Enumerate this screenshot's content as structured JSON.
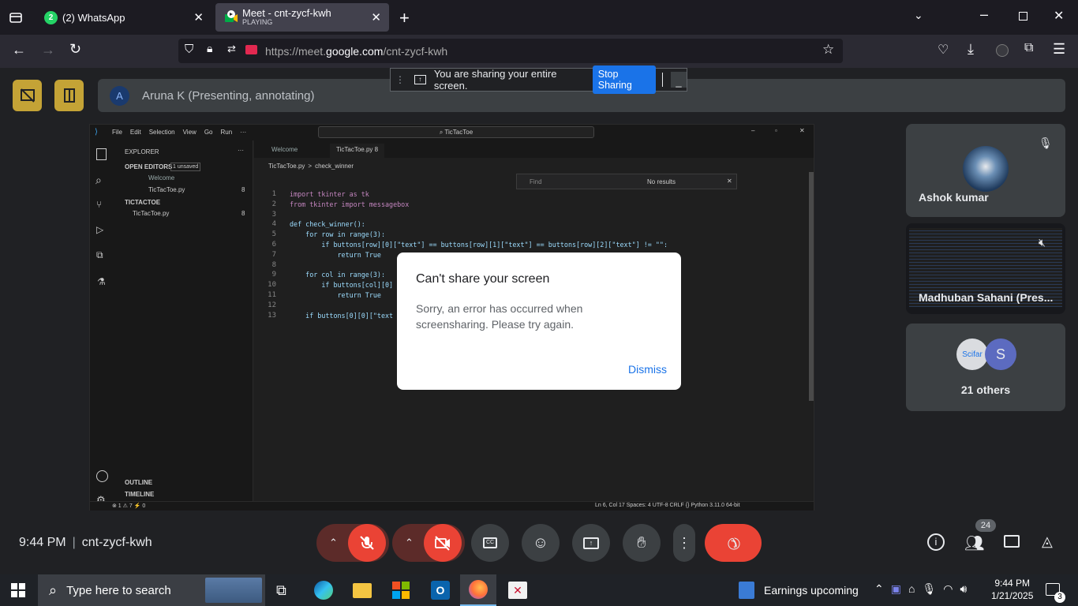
{
  "browser": {
    "tabs": [
      {
        "title": "(2) WhatsApp",
        "badge": "2"
      },
      {
        "title": "Meet - cnt-zycf-kwh",
        "subtitle": "PLAYING"
      }
    ],
    "url_prefix": "https://meet.",
    "url_domain": "google.com",
    "url_suffix": "/cnt-zycf-kwh"
  },
  "share_bar": {
    "message": "You are sharing your entire screen.",
    "stop_label": "Stop Sharing",
    "minimize_label": "_"
  },
  "meet": {
    "presenter_avatar": "A",
    "presenter_label": "Aruna K (Presenting, annotating)",
    "time": "9:44 PM",
    "separator": "|",
    "meeting_code": "cnt-zycf-kwh",
    "participant_count": "24",
    "tiles": [
      {
        "name": "Ashok kumar"
      },
      {
        "name": "Madhuban Sahani (Pres..."
      },
      {
        "name": "21 others",
        "avatars": [
          "Scifar",
          "S"
        ]
      }
    ]
  },
  "dialog": {
    "title": "Can't share your screen",
    "body": "Sorry, an error has occurred when screensharing. Please try again.",
    "dismiss_label": "Dismiss"
  },
  "vscode": {
    "menu": [
      "File",
      "Edit",
      "Selection",
      "View",
      "Go",
      "Run",
      "···"
    ],
    "search": "TicTacToe",
    "explorer_title": "EXPLORER",
    "open_editors": "OPEN EDITORS",
    "unsaved": "1 unsaved",
    "open_files": [
      "Welcome",
      "TicTacToe.py"
    ],
    "folder": "TICTACTOE",
    "folder_file": "TicTacToe.py",
    "file_badge": "8",
    "tabs": [
      "Welcome",
      "TicTacToe.py 8"
    ],
    "breadcrumb": [
      "TicTacToe.py",
      ">",
      "check_winner"
    ],
    "find_placeholder": "Find",
    "find_result": "No results",
    "outline": "OUTLINE",
    "timeline": "TIMELINE",
    "line_numbers": [
      "1",
      "2",
      "3",
      "4",
      "5",
      "6",
      "7",
      "8",
      "9",
      "10",
      "11",
      "12",
      "13"
    ],
    "code": [
      "import tkinter as tk",
      "from tkinter import messagebox",
      "",
      "def check_winner():",
      "    for row in range(3):",
      "        if buttons[row][0][\"text\"] == buttons[row][1][\"text\"] == buttons[row][2][\"text\"] != \"\":",
      "            return True",
      "",
      "    for col in range(3):",
      "        if buttons[col][0]",
      "            return True",
      "",
      "    if buttons[0][0][\"text"
    ],
    "status_left": "⊗ 1 ⚠ 7   ⚡ 0",
    "status_right": "Ln 6, Col 17   Spaces: 4   UTF-8   CRLF   {} Python   3.11.0 64-bit"
  },
  "taskbar": {
    "search_placeholder": "Type here to search",
    "weather": "Earnings upcoming",
    "clock_time": "9:44 PM",
    "clock_date": "1/21/2025",
    "notification_count": "3"
  },
  "colors": {
    "accent": "#1a73e8",
    "end_call": "#ea4335",
    "presenter_yellow": "#c4a336"
  }
}
